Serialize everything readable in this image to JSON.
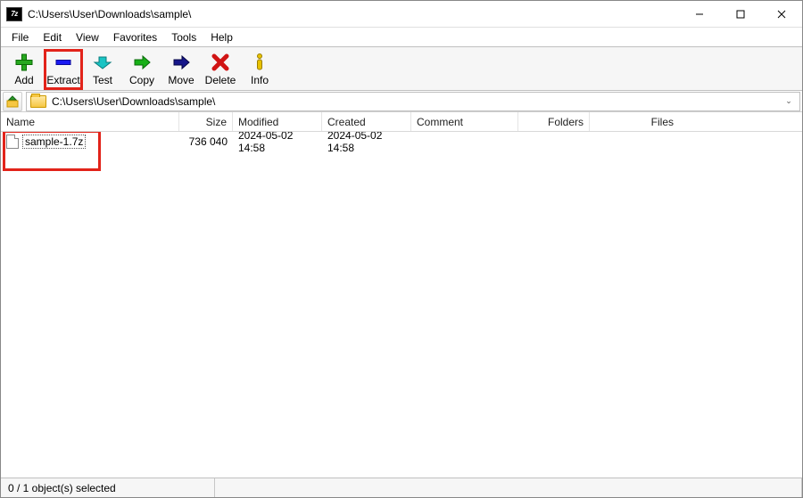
{
  "title": "C:\\Users\\User\\Downloads\\sample\\",
  "menu": {
    "file": "File",
    "edit": "Edit",
    "view": "View",
    "favorites": "Favorites",
    "tools": "Tools",
    "help": "Help"
  },
  "toolbar": {
    "add": "Add",
    "extract": "Extract",
    "test": "Test",
    "copy": "Copy",
    "move": "Move",
    "delete": "Delete",
    "info": "Info"
  },
  "address": {
    "path": "C:\\Users\\User\\Downloads\\sample\\"
  },
  "columns": {
    "name": "Name",
    "size": "Size",
    "modified": "Modified",
    "created": "Created",
    "comment": "Comment",
    "folders": "Folders",
    "files": "Files"
  },
  "rows": [
    {
      "name": "sample-1.7z",
      "size": "736 040",
      "modified": "2024-05-02 14:58",
      "created": "2024-05-02 14:58",
      "comment": "",
      "folders": "",
      "files": ""
    }
  ],
  "status": {
    "selection": "0 / 1 object(s) selected"
  }
}
